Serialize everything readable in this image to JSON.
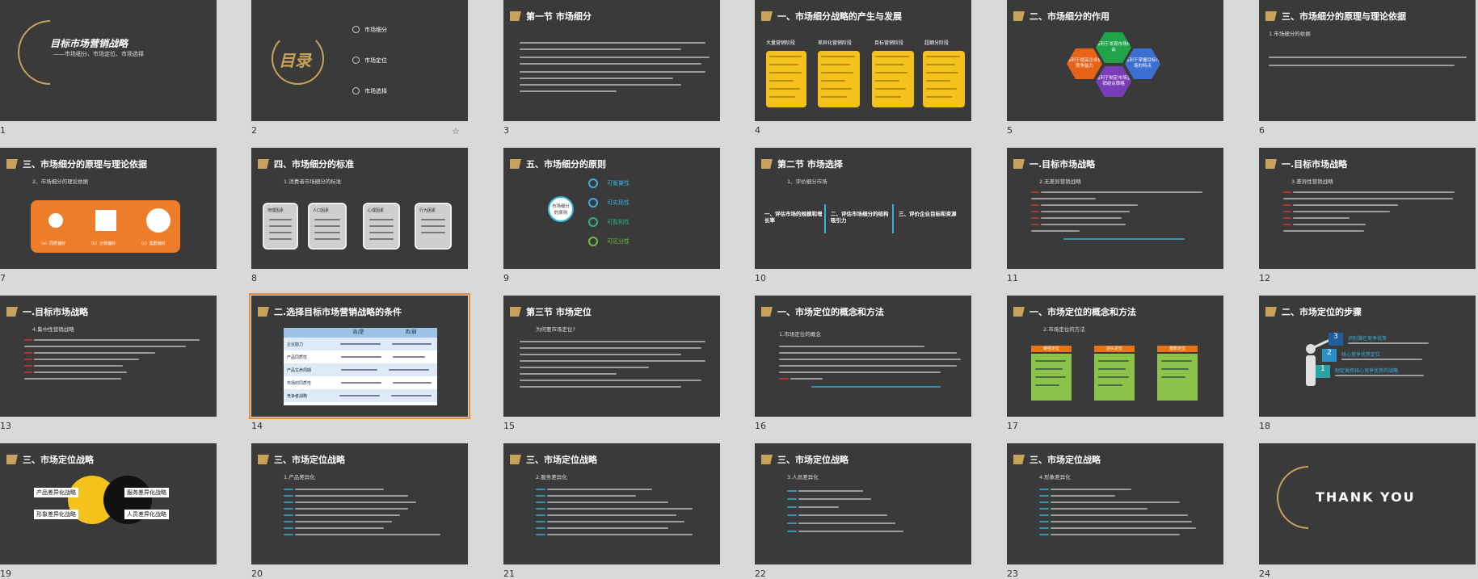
{
  "slides": [
    {
      "num": "1",
      "title": "目标市场营销战略",
      "subtitle": "——市场细分、市场定位、市场选择"
    },
    {
      "num": "2",
      "title": "目录",
      "items": [
        "市场细分",
        "市场定位",
        "市场选择"
      ],
      "star": "☆"
    },
    {
      "num": "3",
      "title": "第一节 市场细分"
    },
    {
      "num": "4",
      "title": "一、市场细分战略的产生与发展",
      "cols": [
        "大量营销阶段",
        "差异化营销阶段",
        "目标营销阶段",
        "超细分阶段"
      ]
    },
    {
      "num": "5",
      "title": "二、市场细分的作用",
      "hexes": [
        "有利于发现市场机会",
        "有利于掌握目标市场的特点",
        "有利于制定市场营销组合策略",
        "有利于提高企业的竞争能力"
      ]
    },
    {
      "num": "6",
      "title": "三、市场细分的原理与理论依据",
      "sub": "1.市场细分的依据"
    },
    {
      "num": "7",
      "title": "三、市场细分的原理与理论依据",
      "sub": "2、市场细分的理论依据",
      "captions": [
        "（a）同质偏好",
        "（b）分散偏好",
        "（c）集群偏好"
      ]
    },
    {
      "num": "8",
      "title": "四、市场细分的标准",
      "sub": "1.消费者市场细分的标准",
      "boxes": [
        "地理因素",
        "人口因素",
        "心理因素",
        "行为因素"
      ]
    },
    {
      "num": "9",
      "title": "五、市场细分的原则",
      "center": "市场细分的原则",
      "items": [
        "可衡量性",
        "可实现性",
        "可盈利性",
        "可区分性"
      ]
    },
    {
      "num": "10",
      "title": "第二节 市场选择",
      "sub": "1、评价细分市场",
      "steps": [
        "一、评估市场的规模和增长率",
        "二、评估市场细分的结构吸引力",
        "三、评价企业目标和资源"
      ]
    },
    {
      "num": "11",
      "title": "一.目标市场战略",
      "sub": "2.无差异营销战略"
    },
    {
      "num": "12",
      "title": "一.目标市场战略",
      "sub": "3.差异性营销战略"
    },
    {
      "num": "13",
      "title": "一.目标市场战略",
      "sub": "4.集中性营销战略"
    },
    {
      "num": "14",
      "title": "二.选择目标市场营销战略的条件",
      "table_head": [
        "",
        "肯/是",
        "否/弱"
      ],
      "table_rows": [
        "企业能力",
        "产品同质性",
        "产品生命周期",
        "市场的同质性",
        "竞争者战略"
      ]
    },
    {
      "num": "15",
      "title": "第三节 市场定位",
      "sub": "为何要市场定位?"
    },
    {
      "num": "16",
      "title": "一、市场定位的概念和方法",
      "sub": "1.市场定位的概念"
    },
    {
      "num": "17",
      "title": "一、市场定位的概念和方法",
      "sub": "2.市场定位的方法",
      "tabs": [
        "避强定位",
        "迎头定位",
        "重新定位"
      ]
    },
    {
      "num": "18",
      "title": "二、市场定位的步骤",
      "steps": [
        "识别潜在竞争优势",
        "核心竞争优势定位",
        "制定发挥核心竞争优势的战略"
      ]
    },
    {
      "num": "19",
      "title": "三、市场定位战略",
      "labels": [
        "产品差异化战略",
        "服务差异化战略",
        "形象差异化战略",
        "人员差异化战略"
      ]
    },
    {
      "num": "20",
      "title": "三、市场定位战略",
      "sub": "1.产品差异化"
    },
    {
      "num": "21",
      "title": "三、市场定位战略",
      "sub": "2.服务差异化"
    },
    {
      "num": "22",
      "title": "三、市场定位战略",
      "sub": "3.人员差异化"
    },
    {
      "num": "23",
      "title": "三、市场定位战略",
      "sub": "4.形象差异化"
    },
    {
      "num": "24",
      "title": "THANK YOU"
    }
  ],
  "colors": {
    "slide_bg": "#3a3a3a",
    "page_bg": "#d9d9d9",
    "gold": "#c8a15a",
    "accent_select": "#e58b3c"
  }
}
